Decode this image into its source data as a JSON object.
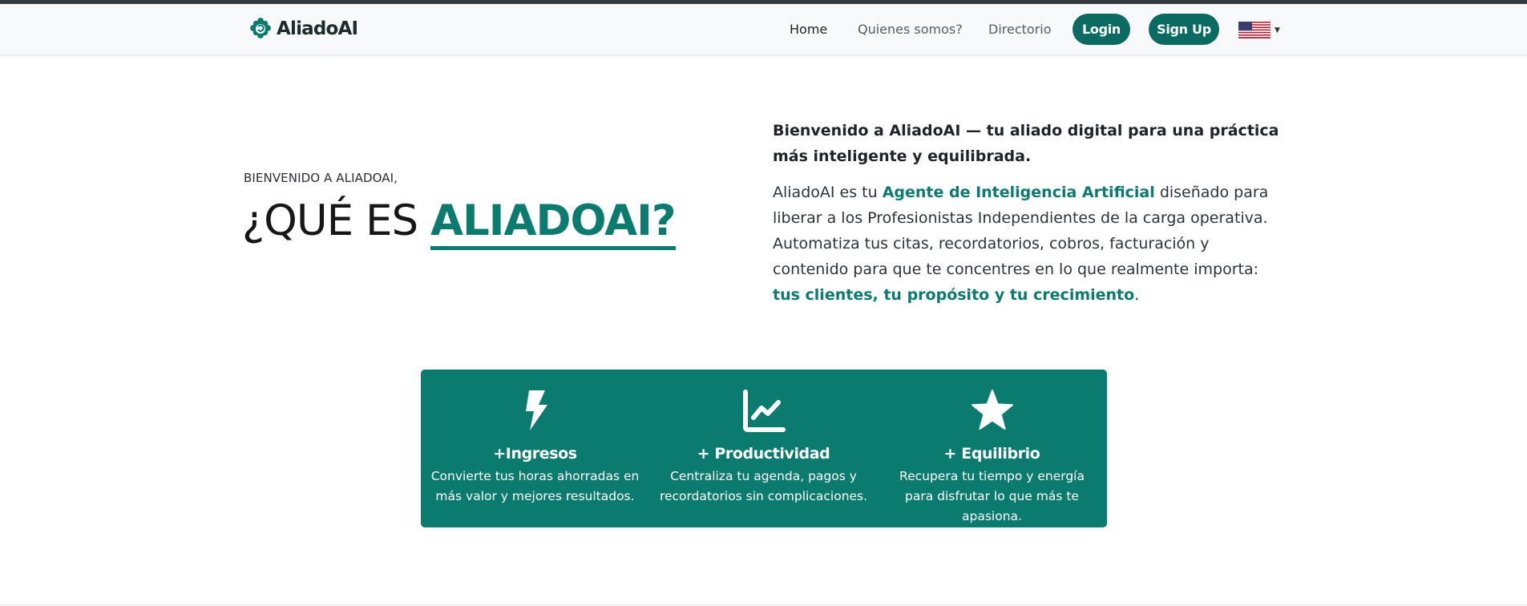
{
  "brand": {
    "name": "AliadoAI",
    "logo_icon": "brain-gear-icon",
    "color": "#0b7a6f"
  },
  "nav": {
    "links": [
      {
        "label": "Home",
        "active": true
      },
      {
        "label": "Quienes somos?",
        "active": false
      },
      {
        "label": "Directorio",
        "active": false
      }
    ],
    "login_label": "Login",
    "signup_label": "Sign Up",
    "language": {
      "icon": "us-flag-icon",
      "caret": "chevron-down-icon"
    }
  },
  "hero": {
    "kicker": "BIENVENIDO A ALIADOAI,",
    "title_prefix": "¿QUÉ ES ",
    "title_accent": "ALIADOAI?"
  },
  "intro": {
    "lead": "Bienvenido a AliadoAI — tu aliado digital para una práctica más inteligente y equilibrada.",
    "body_1": "AliadoAI es tu ",
    "body_hl_1": "Agente de Inteligencia Artificial",
    "body_2": " diseñado para liberar a los Profesionistas Independientes de la carga operativa. Automatiza tus citas, recordatorios, cobros, facturación y contenido para que te concentres en lo que realmente importa: ",
    "body_hl_2": "tus clientes, tu propósito y tu crecimiento",
    "body_3": "."
  },
  "features": [
    {
      "icon": "lightning-bolt-icon",
      "title": "+Ingresos",
      "desc": "Convierte tus horas ahorradas en más valor y mejores resultados."
    },
    {
      "icon": "chart-line-icon",
      "title": "+ Productividad",
      "desc": "Centraliza tu agenda, pagos y recordatorios sin complicaciones."
    },
    {
      "icon": "star-icon",
      "title": "+ Equilibrio",
      "desc": "Recupera tu tiempo y energía para disfrutar lo que más te apasiona."
    }
  ],
  "colors": {
    "accent": "#0b7a6f",
    "button": "#0b6b63",
    "nav_bg": "#f8f9fa"
  }
}
